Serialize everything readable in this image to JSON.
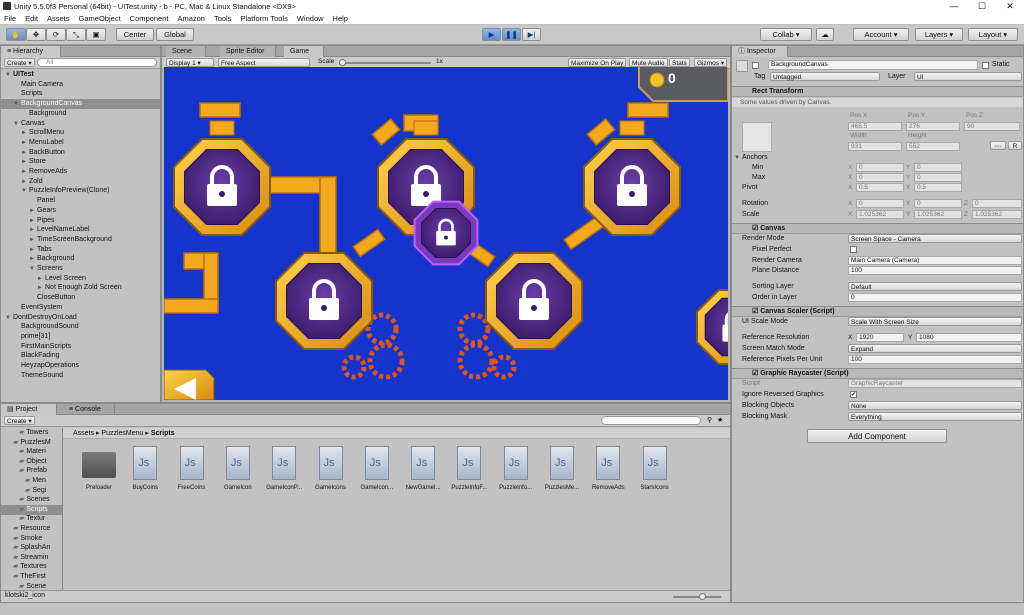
{
  "window": {
    "title": "Unity 5.5.0f3 Personal (64bit) - UITest.unity - b - PC, Mac & Linux Standalone <DX9>",
    "minimize": "—",
    "maximize": "☐",
    "close": "✕"
  },
  "menu": [
    "File",
    "Edit",
    "Assets",
    "GameObject",
    "Component",
    "Amazon",
    "Tools",
    "Platform Tools",
    "Window",
    "Help"
  ],
  "toolbar": {
    "pivot": "Center",
    "space": "Global",
    "collab": "Collab",
    "account": "Account",
    "layers": "Layers",
    "layout": "Layout"
  },
  "hierarchy": {
    "tab": "Hierarchy",
    "create": "Create",
    "search_placeholder": "All",
    "items": [
      {
        "label": "UITest",
        "depth": 0,
        "arrow": "▼",
        "bold": true,
        "sel": false
      },
      {
        "label": "Main Camera",
        "depth": 1,
        "arrow": "",
        "sel": false
      },
      {
        "label": "Scripts",
        "depth": 1,
        "arrow": "",
        "sel": false
      },
      {
        "label": "BackgroundCanvas",
        "depth": 1,
        "arrow": "▼",
        "sel": true
      },
      {
        "label": "Background",
        "depth": 2,
        "arrow": "",
        "sel": false
      },
      {
        "label": "Canvas",
        "depth": 1,
        "arrow": "▼",
        "sel": false
      },
      {
        "label": "ScrollMenu",
        "depth": 2,
        "arrow": "►",
        "sel": false
      },
      {
        "label": "MenuLabel",
        "depth": 2,
        "arrow": "►",
        "sel": false
      },
      {
        "label": "BackButton",
        "depth": 2,
        "arrow": "►",
        "sel": false
      },
      {
        "label": "Store",
        "depth": 2,
        "arrow": "►",
        "sel": false
      },
      {
        "label": "RemoveAds",
        "depth": 2,
        "arrow": "►",
        "sel": false
      },
      {
        "label": "Zold",
        "depth": 2,
        "arrow": "►",
        "sel": false
      },
      {
        "label": "PuzzleInfoPreview(Clone)",
        "depth": 2,
        "arrow": "▼",
        "sel": false
      },
      {
        "label": "Panel",
        "depth": 3,
        "arrow": "",
        "sel": false
      },
      {
        "label": "Gears",
        "depth": 3,
        "arrow": "►",
        "sel": false
      },
      {
        "label": "Pipes",
        "depth": 3,
        "arrow": "►",
        "sel": false
      },
      {
        "label": "LevelNameLabel",
        "depth": 3,
        "arrow": "►",
        "sel": false
      },
      {
        "label": "TimeScreenBackground",
        "depth": 3,
        "arrow": "►",
        "sel": false
      },
      {
        "label": "Tabs",
        "depth": 3,
        "arrow": "►",
        "sel": false
      },
      {
        "label": "Background",
        "depth": 3,
        "arrow": "►",
        "sel": false
      },
      {
        "label": "Screens",
        "depth": 3,
        "arrow": "▼",
        "sel": false
      },
      {
        "label": "Level Screen",
        "depth": 4,
        "arrow": "►",
        "sel": false
      },
      {
        "label": "Not Enough Zold Screen",
        "depth": 4,
        "arrow": "►",
        "sel": false
      },
      {
        "label": "CloseButton",
        "depth": 3,
        "arrow": "",
        "sel": false
      },
      {
        "label": "EventSystem",
        "depth": 1,
        "arrow": "",
        "sel": false
      },
      {
        "label": "DontDestroyOnLoad",
        "depth": 0,
        "arrow": "▼",
        "sel": false
      },
      {
        "label": "BackgroundSound",
        "depth": 1,
        "arrow": "",
        "sel": false
      },
      {
        "label": "prime[31]",
        "depth": 1,
        "arrow": "",
        "sel": false
      },
      {
        "label": "FirstMainScripts",
        "depth": 1,
        "arrow": "",
        "sel": false
      },
      {
        "label": "BlackFading",
        "depth": 1,
        "arrow": "",
        "sel": false
      },
      {
        "label": "HeyzapOperations",
        "depth": 1,
        "arrow": "",
        "sel": false
      },
      {
        "label": "ThemeSound",
        "depth": 1,
        "arrow": "",
        "sel": false
      }
    ]
  },
  "scene_tabs": [
    "Scene",
    "Sprite Editor",
    "Game"
  ],
  "game_bar": {
    "display": "Display 1",
    "aspect": "Free Aspect",
    "scale_label": "Scale",
    "scale_value": "1x",
    "maximize": "Maximize On Play",
    "mute": "Mute Audio",
    "stats": "Stats",
    "gizmos": "Gizmos"
  },
  "game": {
    "coins": "0"
  },
  "project": {
    "tabs": [
      "Project",
      "Console"
    ],
    "create": "Create",
    "breadcrumb": [
      "Assets",
      "PuzzlesMenu",
      "Scripts"
    ],
    "tree": [
      {
        "label": "Towers",
        "depth": 2
      },
      {
        "label": "PuzzlesM",
        "depth": 1
      },
      {
        "label": "Materi",
        "depth": 2
      },
      {
        "label": "Object",
        "depth": 2
      },
      {
        "label": "Prefab",
        "depth": 2
      },
      {
        "label": "Men",
        "depth": 3
      },
      {
        "label": "Segi",
        "depth": 3
      },
      {
        "label": "Scenes",
        "depth": 2
      },
      {
        "label": "Scripts",
        "depth": 2
      },
      {
        "label": "Textur",
        "depth": 2
      },
      {
        "label": "Resource",
        "depth": 1
      },
      {
        "label": "Smoke",
        "depth": 1
      },
      {
        "label": "SplashAn",
        "depth": 1
      },
      {
        "label": "Streamin",
        "depth": 1
      },
      {
        "label": "Textures",
        "depth": 1
      },
      {
        "label": "TheFirst",
        "depth": 1
      },
      {
        "label": "Scene",
        "depth": 2
      },
      {
        "label": "Scripts",
        "depth": 2
      }
    ],
    "assets": [
      "Preloader",
      "BuyCoins",
      "FreeCoins",
      "GameIcon",
      "GameIconP...",
      "GameIcons",
      "GameIcon...",
      "NewGameI...",
      "PuzzleInfoF...",
      "PuzzleInfo...",
      "PuzzlesMe...",
      "RemoveAds",
      "StarsIcons"
    ],
    "status": "klotski2_icon"
  },
  "inspector": {
    "tab": "Inspector",
    "object_name": "BackgroundCanvas",
    "static": "Static",
    "tag_label": "Tag",
    "tag": "Untagged",
    "layer_label": "Layer",
    "layer": "UI",
    "rect": {
      "title": "Rect Transform",
      "note": "Some values driven by Canvas.",
      "posx_l": "Pos X",
      "posy_l": "Pos Y",
      "posz_l": "Pos Z",
      "posx": "465.5",
      "posy": "276",
      "posz": "90",
      "w_l": "Width",
      "h_l": "Height",
      "w": "931",
      "h": "552",
      "anchors": "Anchors",
      "min": "Min",
      "max": "Max",
      "minx": "0",
      "miny": "0",
      "maxx": "0",
      "maxy": "0",
      "pivot": "Pivot",
      "pivx": "0.5",
      "pivy": "0.5",
      "rotation": "Rotation",
      "rx": "0",
      "ry": "0",
      "rz": "0",
      "scale": "Scale",
      "sx": "1.025362",
      "sy": "1.025362",
      "sz": "1.025362",
      "R": "R"
    },
    "canvas": {
      "title": "Canvas",
      "render_mode_l": "Render Mode",
      "render_mode": "Screen Space - Camera",
      "pixel_perfect_l": "Pixel Perfect",
      "render_camera_l": "Render Camera",
      "render_camera": "Main Camera (Camera)",
      "plane_distance_l": "Plane Distance",
      "plane_distance": "100",
      "sorting_layer_l": "Sorting Layer",
      "sorting_layer": "Default",
      "order_l": "Order in Layer",
      "order": "0"
    },
    "scaler": {
      "title": "Canvas Scaler (Script)",
      "ui_scale_l": "UI Scale Mode",
      "ui_scale": "Scale With Screen Size",
      "ref_res_l": "Reference Resolution",
      "refx": "1920",
      "refy": "1080",
      "match_l": "Screen Match Mode",
      "match": "Expand",
      "ppu_l": "Reference Pixels Per Unit",
      "ppu": "100"
    },
    "raycaster": {
      "title": "Graphic Raycaster (Script)",
      "script_l": "Script",
      "script": "GraphicRaycaster",
      "ignore_l": "Ignore Reversed Graphics",
      "block_obj_l": "Blocking Objects",
      "block_obj": "None",
      "block_mask_l": "Blocking Mask",
      "block_mask": "Everything"
    },
    "add_component": "Add Component"
  }
}
